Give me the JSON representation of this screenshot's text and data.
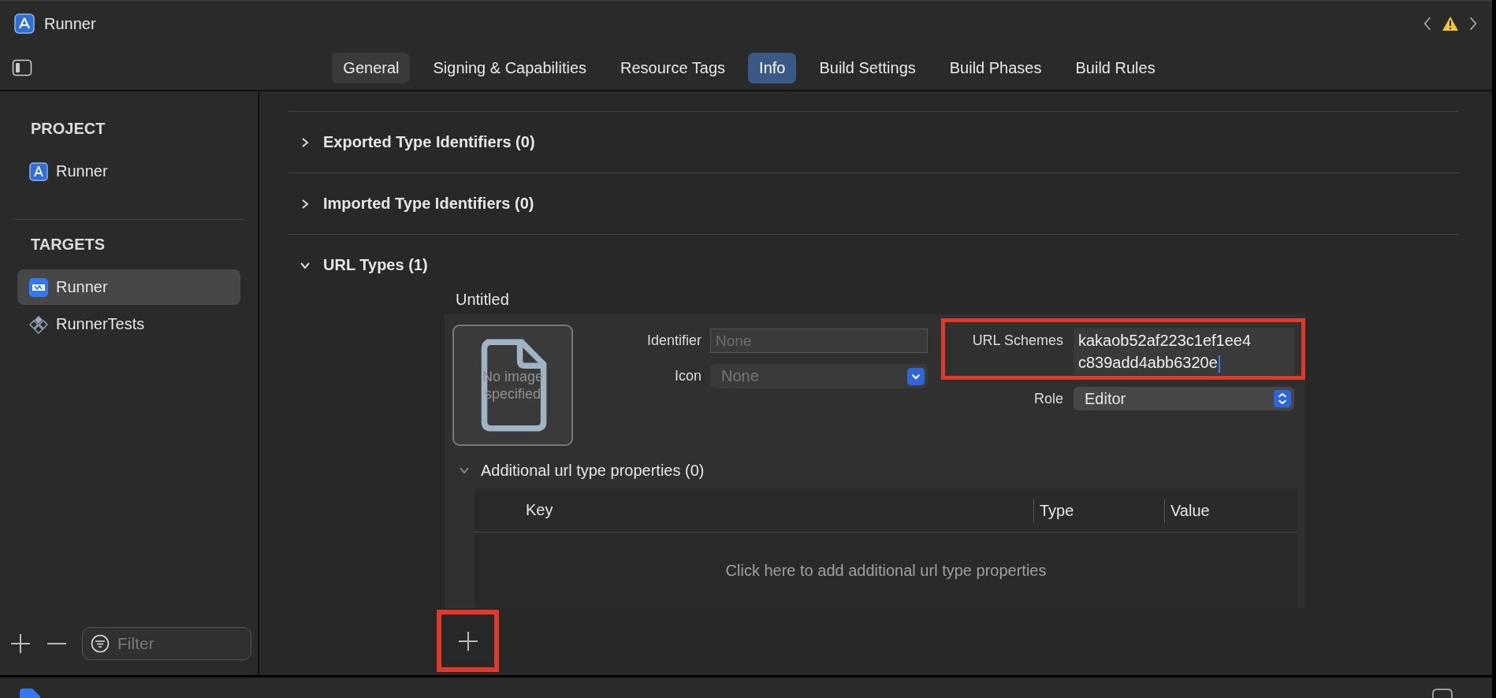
{
  "window": {
    "title": "Runner"
  },
  "tabs": [
    {
      "label": "General",
      "selected": false,
      "hovered": true
    },
    {
      "label": "Signing & Capabilities",
      "selected": false,
      "hovered": false
    },
    {
      "label": "Resource Tags",
      "selected": false,
      "hovered": false
    },
    {
      "label": "Info",
      "selected": true,
      "hovered": false
    },
    {
      "label": "Build Settings",
      "selected": false,
      "hovered": false
    },
    {
      "label": "Build Phases",
      "selected": false,
      "hovered": false
    },
    {
      "label": "Build Rules",
      "selected": false,
      "hovered": false
    }
  ],
  "sidebar": {
    "sections": [
      {
        "title": "PROJECT",
        "items": [
          {
            "label": "Runner",
            "kind": "project",
            "selected": false
          }
        ]
      },
      {
        "title": "TARGETS",
        "items": [
          {
            "label": "Runner",
            "kind": "app",
            "selected": true
          },
          {
            "label": "RunnerTests",
            "kind": "tests",
            "selected": false
          }
        ]
      }
    ],
    "filter": {
      "placeholder": "Filter"
    }
  },
  "sections": [
    {
      "title": "Exported Type Identifiers (0)",
      "expanded": false
    },
    {
      "title": "Imported Type Identifiers (0)",
      "expanded": false
    },
    {
      "title": "URL Types (1)",
      "expanded": true
    }
  ],
  "url_type": {
    "name": "Untitled",
    "image_placeholder": "No image specified",
    "identifier": {
      "label": "Identifier",
      "placeholder": "None"
    },
    "icon": {
      "label": "Icon",
      "value": "None"
    },
    "url_schemes": {
      "label": "URL Schemes",
      "value": "kakaob52af223c1ef1ee4c839add4abb6320e",
      "highlighted": true
    },
    "role": {
      "label": "Role",
      "value": "Editor"
    },
    "additional": {
      "title": "Additional url type properties (0)",
      "expanded": true,
      "columns": [
        "Key",
        "Type",
        "Value"
      ],
      "empty_text": "Click here to add additional url type properties"
    }
  },
  "add_button": {
    "highlighted": true
  }
}
